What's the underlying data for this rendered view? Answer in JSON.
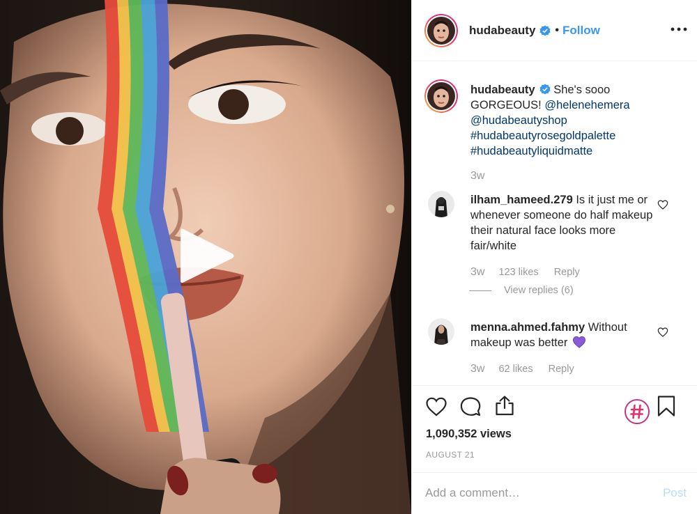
{
  "post": {
    "username": "hudabeauty",
    "follow_label": "Follow",
    "separator": "•",
    "caption_text": "She's sooo GORGEOUS!",
    "caption_mentions": [
      "@helenehemera",
      "@hudabeautyshop"
    ],
    "caption_hashtags": [
      "#hudabeautyrosegoldpalette",
      "#hudabeautyliquidmatte"
    ],
    "caption_time": "3w",
    "views": "1,090,352 views",
    "date": "AUGUST 21"
  },
  "comments": [
    {
      "username": "ilham_hameed.279",
      "text": "Is it just me or whenever someone do half makeup their natural face looks more fair/white",
      "time": "3w",
      "likes": "123 likes",
      "reply_label": "Reply",
      "view_replies": "View replies (6)"
    },
    {
      "username": "menna.ahmed.fahmy",
      "text": "Without makeup was better",
      "emoji": "purple-heart",
      "time": "3w",
      "likes": "62 likes",
      "reply_label": "Reply"
    }
  ],
  "comment_box": {
    "placeholder": "Add a comment…",
    "post_label": "Post"
  },
  "colors": {
    "link": "#00376b",
    "follow": "#3897f0",
    "muted": "#999999",
    "post_disabled": "#b2dffc",
    "hashtag_badge": "#c13584"
  },
  "icons": [
    "verified-badge-icon",
    "more-options-icon",
    "play-icon",
    "heart-icon",
    "comment-icon",
    "share-icon",
    "hashtag-icon",
    "bookmark-icon"
  ]
}
